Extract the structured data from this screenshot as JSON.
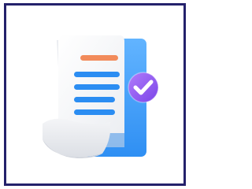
{
  "icon": {
    "name": "document-checkmark-icon",
    "colors": {
      "frame_border": "#24216b",
      "paper": "#f7f7f8",
      "paper_shadow": "#e4e6eb",
      "back_sheet": "#2f8ff3",
      "back_sheet_light": "#62b4ff",
      "header_line": "#f28b5b",
      "text_lines": "#2b8df2",
      "check_badge": "#9a63f5",
      "check_badge_dark": "#7b45e8",
      "checkmark": "#ffffff"
    }
  }
}
